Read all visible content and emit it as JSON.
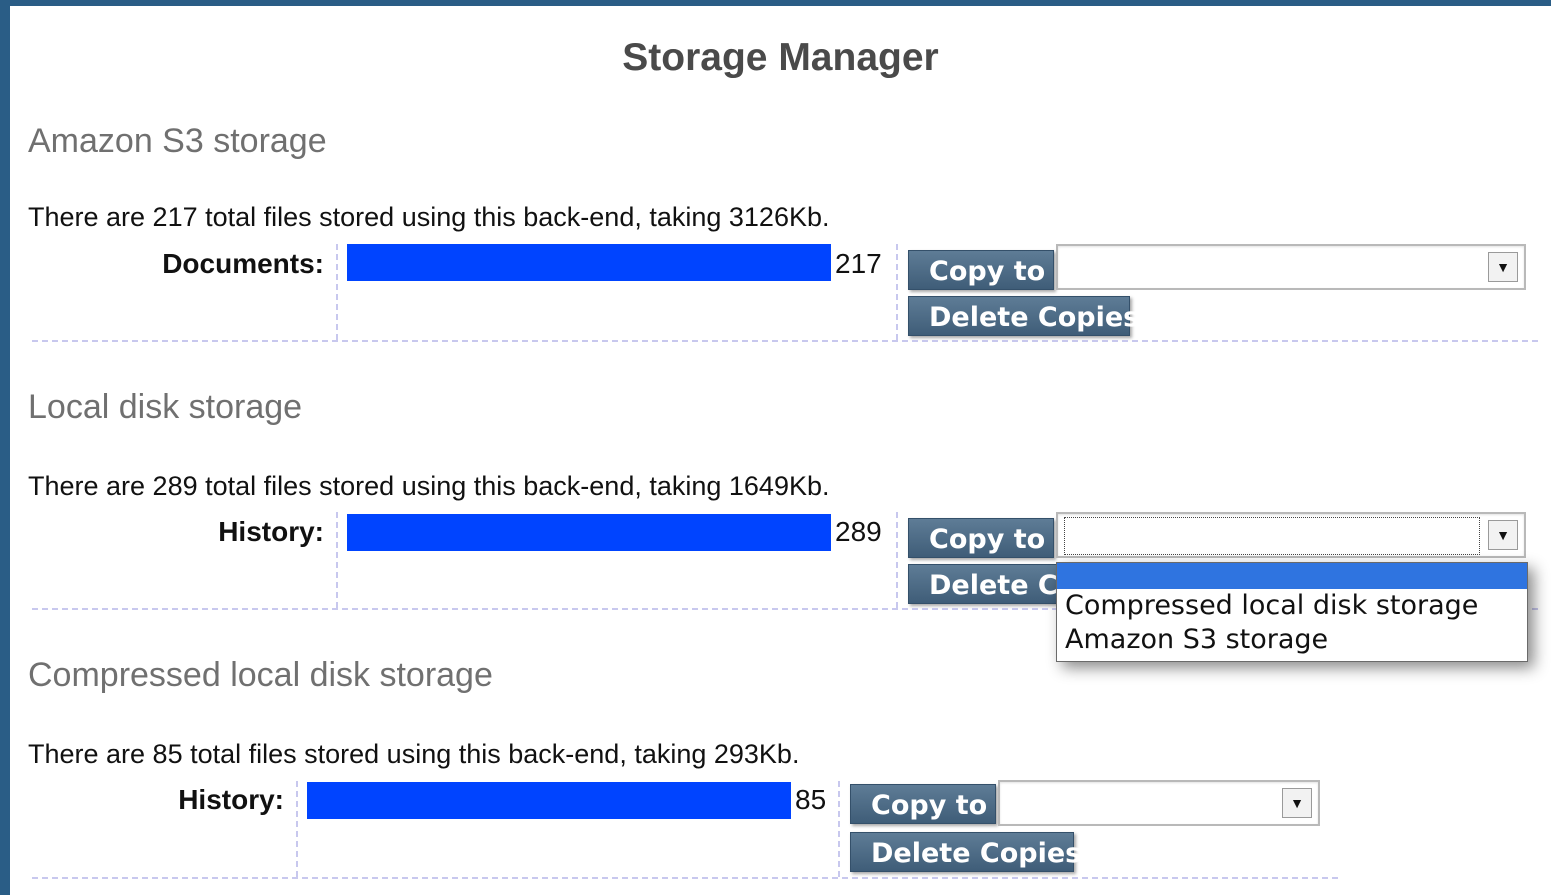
{
  "app": {
    "title": "Storage Manager"
  },
  "sections": [
    {
      "title": "Amazon S3 storage",
      "description": "There are 217 total files stored using this back-end, taking 3126Kb.",
      "rows": [
        {
          "label": "Documents:",
          "count": "217",
          "fraction": 1.0,
          "copy_to_label": "Copy to",
          "copy_target": "",
          "delete_label": "Delete Copies"
        }
      ]
    },
    {
      "title": "Local disk storage",
      "description": "There are 289 total files stored using this back-end, taking 1649Kb.",
      "rows": [
        {
          "label": "History:",
          "count": "289",
          "fraction": 1.0,
          "copy_to_label": "Copy to",
          "copy_target": "",
          "delete_label": "Delete Copies"
        }
      ]
    },
    {
      "title": "Compressed local disk storage",
      "description": "There are 85 total files stored using this back-end, taking 293Kb.",
      "rows": [
        {
          "label": "History:",
          "count": "85",
          "fraction": 1.0,
          "copy_to_label": "Copy to",
          "copy_target": "",
          "delete_label": "Delete Copies"
        }
      ]
    }
  ],
  "dropdown": {
    "open": true,
    "options": [
      "",
      "Compressed local disk storage",
      "Amazon S3 storage"
    ],
    "highlighted_index": 0
  },
  "icons": {
    "select_arrow": "chevron-down-icon"
  },
  "colors": {
    "bar": "#0044ff",
    "button": "#4a6883",
    "highlight": "#2f74e0",
    "background": "#2a5d86"
  }
}
